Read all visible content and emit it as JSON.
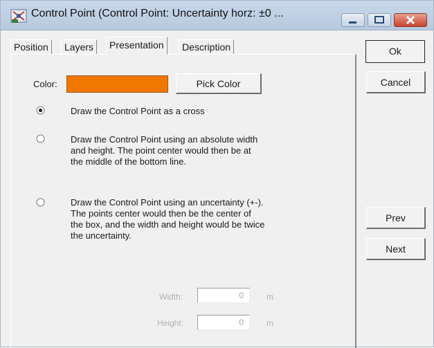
{
  "window": {
    "title": "Control Point  (Control Point: Uncertainty horz: ±0 ..."
  },
  "tabs": [
    {
      "label": "Position"
    },
    {
      "label": "Layers"
    },
    {
      "label": "Presentation",
      "active": true
    },
    {
      "label": "Description"
    }
  ],
  "presentation": {
    "color_label": "Color:",
    "color_value": "#f07800",
    "pick_color_label": "Pick Color",
    "options": [
      {
        "text": "Draw the Control Point as a cross",
        "selected": true
      },
      {
        "text": "Draw the Control Point using an absolute width\nand height. The point center would then be at\nthe middle of the bottom line.",
        "selected": false
      },
      {
        "text": "Draw the Control Point using an uncertainty (+-).\nThe points center would then be the center of\nthe box, and the width and height would be twice\nthe uncertainty.",
        "selected": false
      }
    ],
    "width_label": "Width:",
    "width_value": "0",
    "width_unit": "m",
    "height_label": "Height:",
    "height_value": "0",
    "height_unit": "m"
  },
  "buttons": {
    "ok": "Ok",
    "cancel": "Cancel",
    "prev": "Prev",
    "next": "Next"
  }
}
